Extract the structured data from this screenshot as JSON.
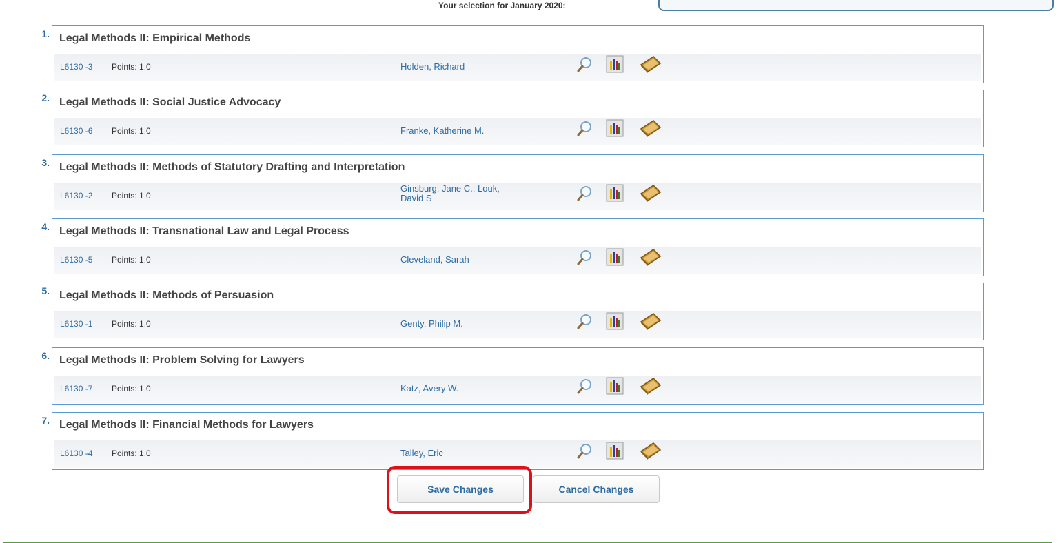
{
  "legend": "Your selection for January 2020:",
  "courses": [
    {
      "num": "1.",
      "title": "Legal Methods II: Empirical Methods",
      "code": "L6130 -3",
      "points": "Points: 1.0",
      "instructor": "Holden, Richard"
    },
    {
      "num": "2.",
      "title": "Legal Methods II: Social Justice Advocacy",
      "code": "L6130 -6",
      "points": "Points: 1.0",
      "instructor": "Franke, Katherine M."
    },
    {
      "num": "3.",
      "title": "Legal Methods II: Methods of Statutory Drafting and Interpretation",
      "code": "L6130 -2",
      "points": "Points: 1.0",
      "instructor": "Ginsburg, Jane C.;  Louk,",
      "instructor_line2": "David S"
    },
    {
      "num": "4.",
      "title": "Legal Methods II: Transnational Law and Legal Process",
      "code": "L6130 -5",
      "points": "Points: 1.0",
      "instructor": "Cleveland, Sarah"
    },
    {
      "num": "5.",
      "title": "Legal Methods II: Methods of Persuasion",
      "code": "L6130 -1",
      "points": "Points: 1.0",
      "instructor": "Genty, Philip M."
    },
    {
      "num": "6.",
      "title": "Legal Methods II: Problem Solving for Lawyers",
      "code": "L6130 -7",
      "points": "Points: 1.0",
      "instructor": "Katz, Avery W."
    },
    {
      "num": "7.",
      "title": "Legal Methods II: Financial Methods for Lawyers",
      "code": "L6130 -4",
      "points": "Points: 1.0",
      "instructor": "Talley, Eric"
    }
  ],
  "icons": [
    "search-icon",
    "evaluation-chart-icon",
    "book-icon"
  ],
  "buttons": {
    "save": "Save Changes",
    "cancel": "Cancel Changes"
  },
  "colors": {
    "accent": "#2e6da4",
    "border": "#5b9bd1",
    "fieldset": "#5aa040",
    "highlight": "#e0101a"
  }
}
